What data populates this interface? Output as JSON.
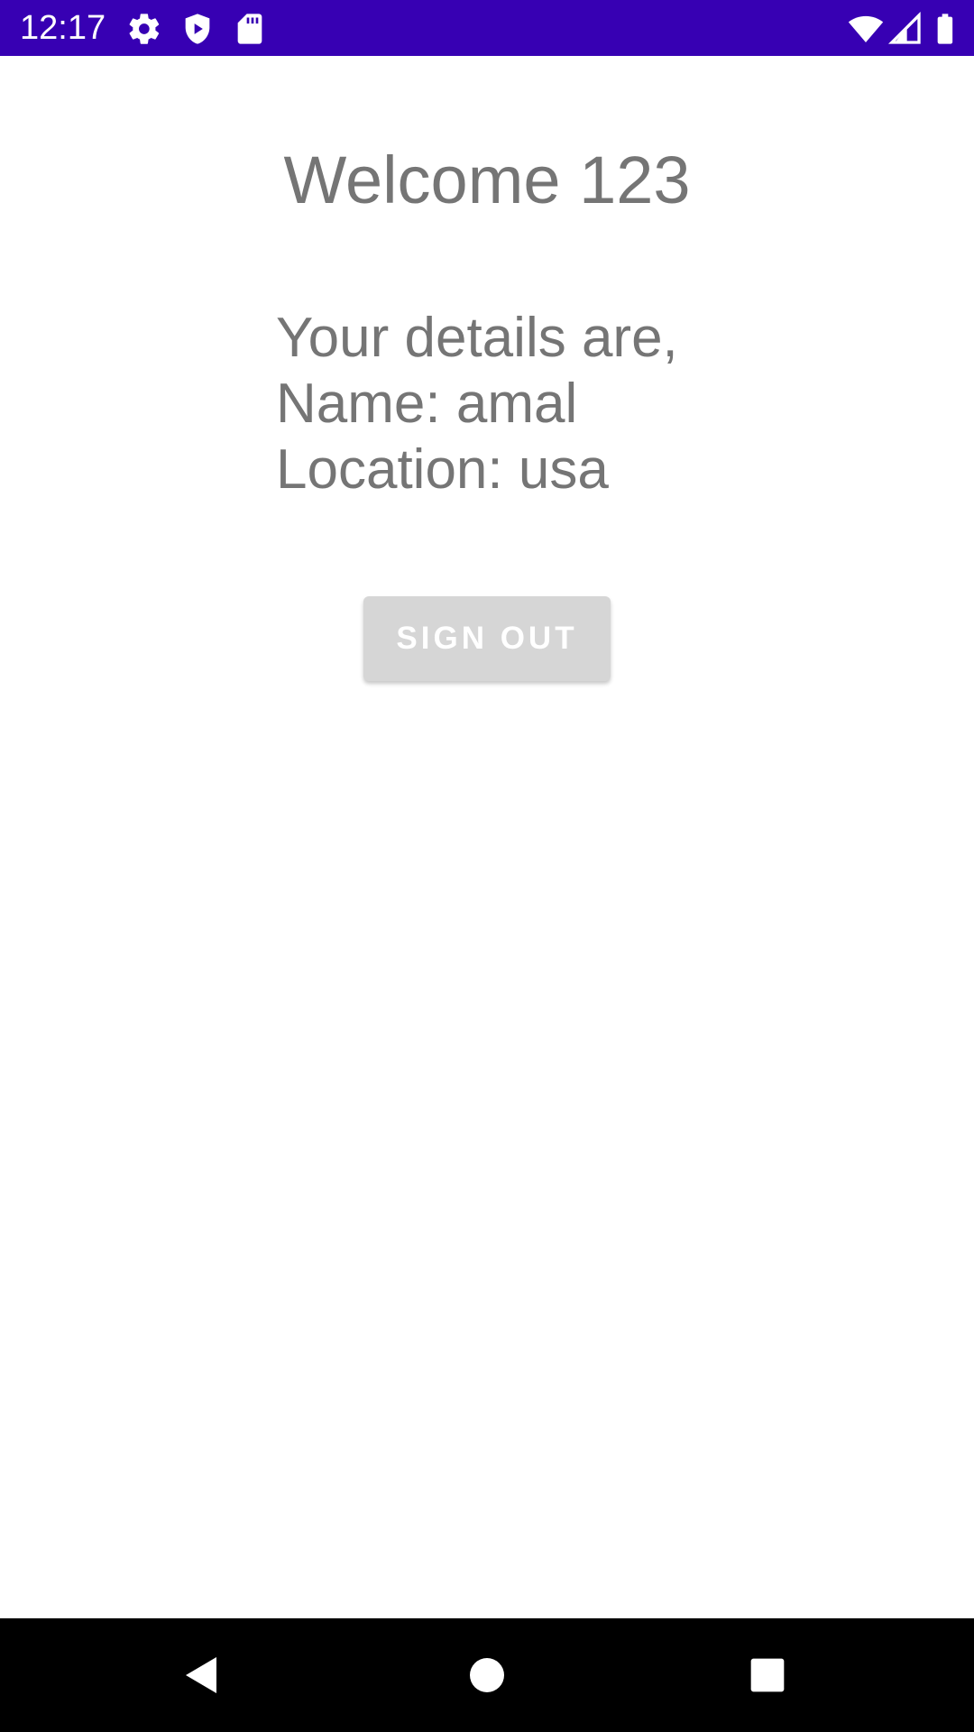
{
  "status_bar": {
    "time": "12:17",
    "background_color": "#3700b3",
    "icons": [
      "settings-gear-icon",
      "shield-play-icon",
      "sd-card-icon",
      "wifi-icon",
      "cell-signal-icon",
      "battery-icon"
    ]
  },
  "main": {
    "title": "Welcome 123",
    "details": {
      "intro": "Your details are,",
      "name_line": "Name: amal",
      "location_line": "Location: usa"
    },
    "sign_out_label": "SIGN OUT",
    "button_color": "#d6d6d6"
  },
  "nav_bar": {
    "buttons": [
      "back-icon",
      "home-icon",
      "recents-icon"
    ]
  }
}
